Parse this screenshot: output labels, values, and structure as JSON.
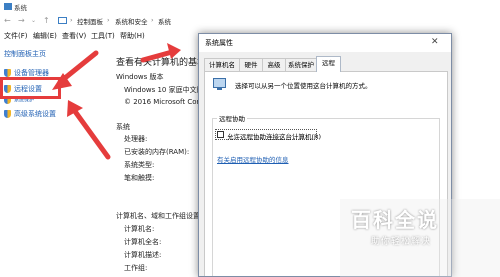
{
  "window": {
    "title": "系统"
  },
  "address": {
    "crumbs": [
      "控制面板",
      "系统和安全",
      "系统"
    ]
  },
  "menu": {
    "items": [
      "文件(F)",
      "编辑(E)",
      "查看(V)",
      "工具(T)",
      "帮助(H)"
    ]
  },
  "sidebar": {
    "home": "控制面板主页",
    "items": [
      {
        "label": "设备管理器",
        "icon": "shield-icon"
      },
      {
        "label": "远程设置",
        "icon": "shield-icon"
      },
      {
        "label": "系统保护",
        "icon": "shield-icon"
      },
      {
        "label": "高级系统设置",
        "icon": "shield-icon"
      }
    ]
  },
  "main": {
    "heading": "查看有关计算机的基本",
    "windows_edition": "Windows 版本",
    "edition_value": "Windows 10 家庭中文版",
    "copyright": "© 2016 Microsoft Corpo",
    "system_section": "系统",
    "system_labels": [
      "处理器:",
      "已安装的内存(RAM):",
      "系统类型:",
      "笔和触摸:"
    ],
    "computer_section": "计算机名、域和工作组设置",
    "computer_labels": [
      "计算机名:",
      "计算机全名:",
      "计算机描述:",
      "工作组:"
    ]
  },
  "dialog": {
    "title": "系统属性",
    "close_glyph": "✕",
    "tabs": [
      "计算机名",
      "硬件",
      "高级",
      "系统保护",
      "远程"
    ],
    "active_tab": "远程",
    "description": "选择可以从另一个位置使用这台计算机的方式。",
    "group_label": "远程协助",
    "checkbox_label": "允许远程协助连接这台计算机(R)",
    "checkbox_checked": false,
    "help_link": "有关启用远程协助的信息"
  },
  "watermark": {
    "main": "百科全说",
    "sub": "助你轻松解决"
  },
  "colors": {
    "highlight": "#e53c3c",
    "link": "#1f5fb3",
    "arrow": "#e53c3c"
  }
}
